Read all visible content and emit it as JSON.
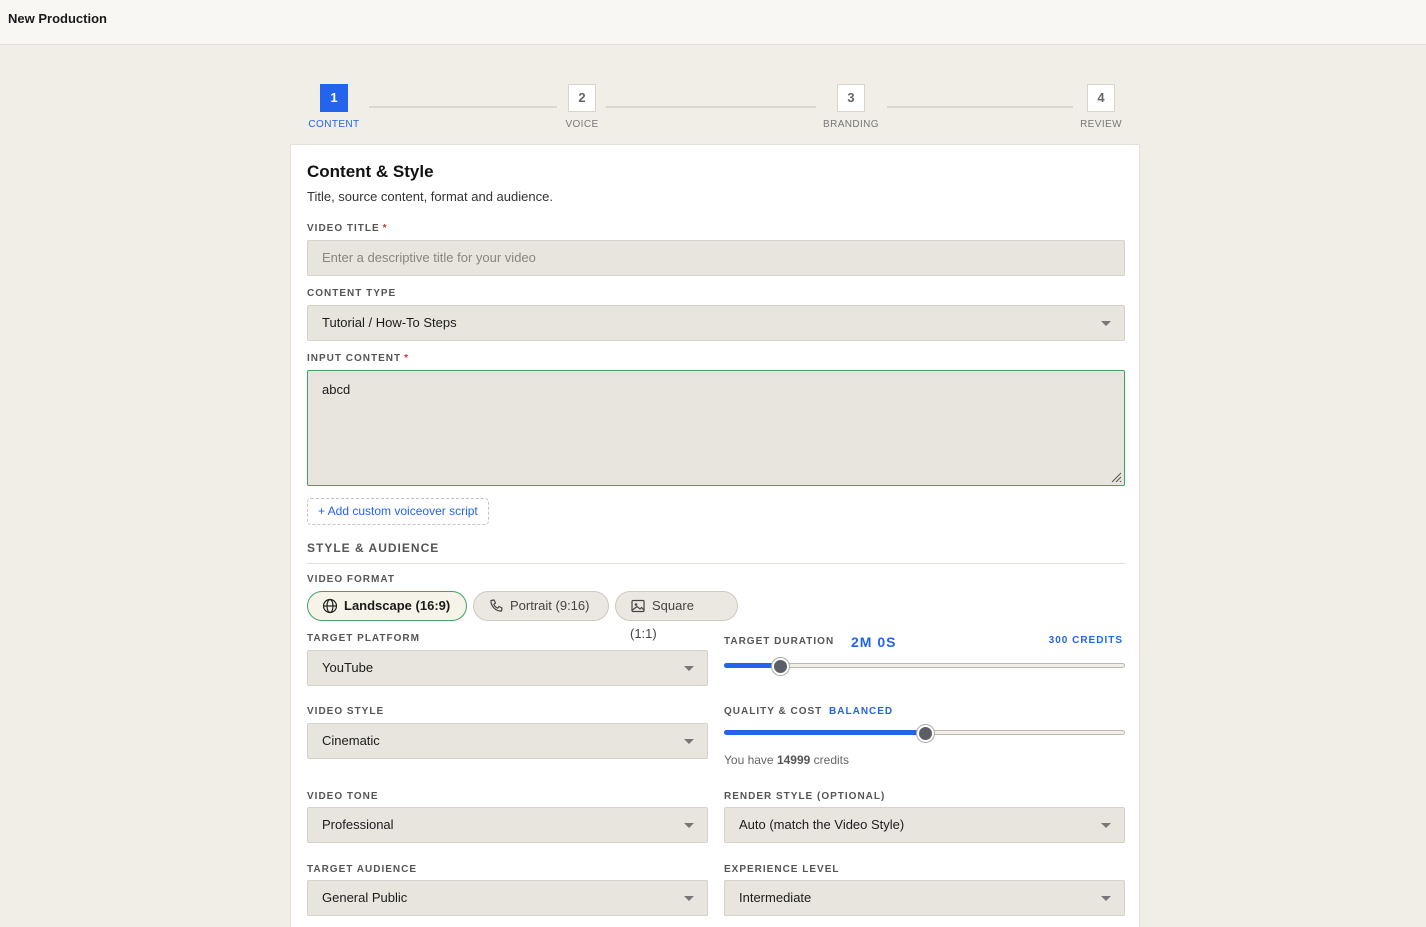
{
  "app": {
    "title": "New Production"
  },
  "stepper": {
    "steps": [
      {
        "num": "1",
        "label": "CONTENT",
        "active": true
      },
      {
        "num": "2",
        "label": "VOICE",
        "active": false
      },
      {
        "num": "3",
        "label": "BRANDING",
        "active": false
      },
      {
        "num": "4",
        "label": "REVIEW",
        "active": false
      }
    ]
  },
  "form": {
    "heading": "Content & Style",
    "subheading": "Title, source content, format and audience.",
    "required_mark": "*",
    "video_title": {
      "label": "VIDEO TITLE",
      "value": "",
      "placeholder": "Enter a descriptive title for your video"
    },
    "content_type": {
      "label": "CONTENT TYPE",
      "value": "Tutorial / How-To Steps"
    },
    "input_content": {
      "label": "INPUT CONTENT",
      "value": "abcd"
    },
    "add_script_label": "+ Add custom voiceover script",
    "style_section": "STYLE & AUDIENCE",
    "video_format": {
      "label": "VIDEO FORMAT",
      "options": [
        {
          "label": "Landscape (16:9)",
          "icon": "globe-icon",
          "selected": true
        },
        {
          "label": "Portrait (9:16)",
          "icon": "phone-icon",
          "selected": false
        },
        {
          "label": "Square (1:1)",
          "icon": "image-icon",
          "selected": false
        }
      ]
    },
    "target_platform": {
      "label": "TARGET PLATFORM",
      "value": "YouTube"
    },
    "target_duration": {
      "label": "TARGET DURATION",
      "value": "2M 0S",
      "credits": "300 CREDITS",
      "level": 0.14
    },
    "video_style": {
      "label": "VIDEO STYLE",
      "value": "Cinematic"
    },
    "quality_cost": {
      "label": "QUALITY & COST",
      "value": "BALANCED",
      "level": 0.5
    },
    "credits_note": {
      "prefix": "You have",
      "amount": "14999",
      "suffix": "credits"
    },
    "video_tone": {
      "label": "VIDEO TONE",
      "value": "Professional"
    },
    "render_style": {
      "label": "RENDER STYLE (OPTIONAL)",
      "value": "Auto (match the Video Style)"
    },
    "target_audience": {
      "label": "TARGET AUDIENCE",
      "value": "General Public"
    },
    "experience_level": {
      "label": "EXPERIENCE LEVEL",
      "value": "Intermediate"
    }
  },
  "colors": {
    "accent": "#2463eb",
    "focus_border": "#3fa561",
    "required": "#d9342b"
  }
}
